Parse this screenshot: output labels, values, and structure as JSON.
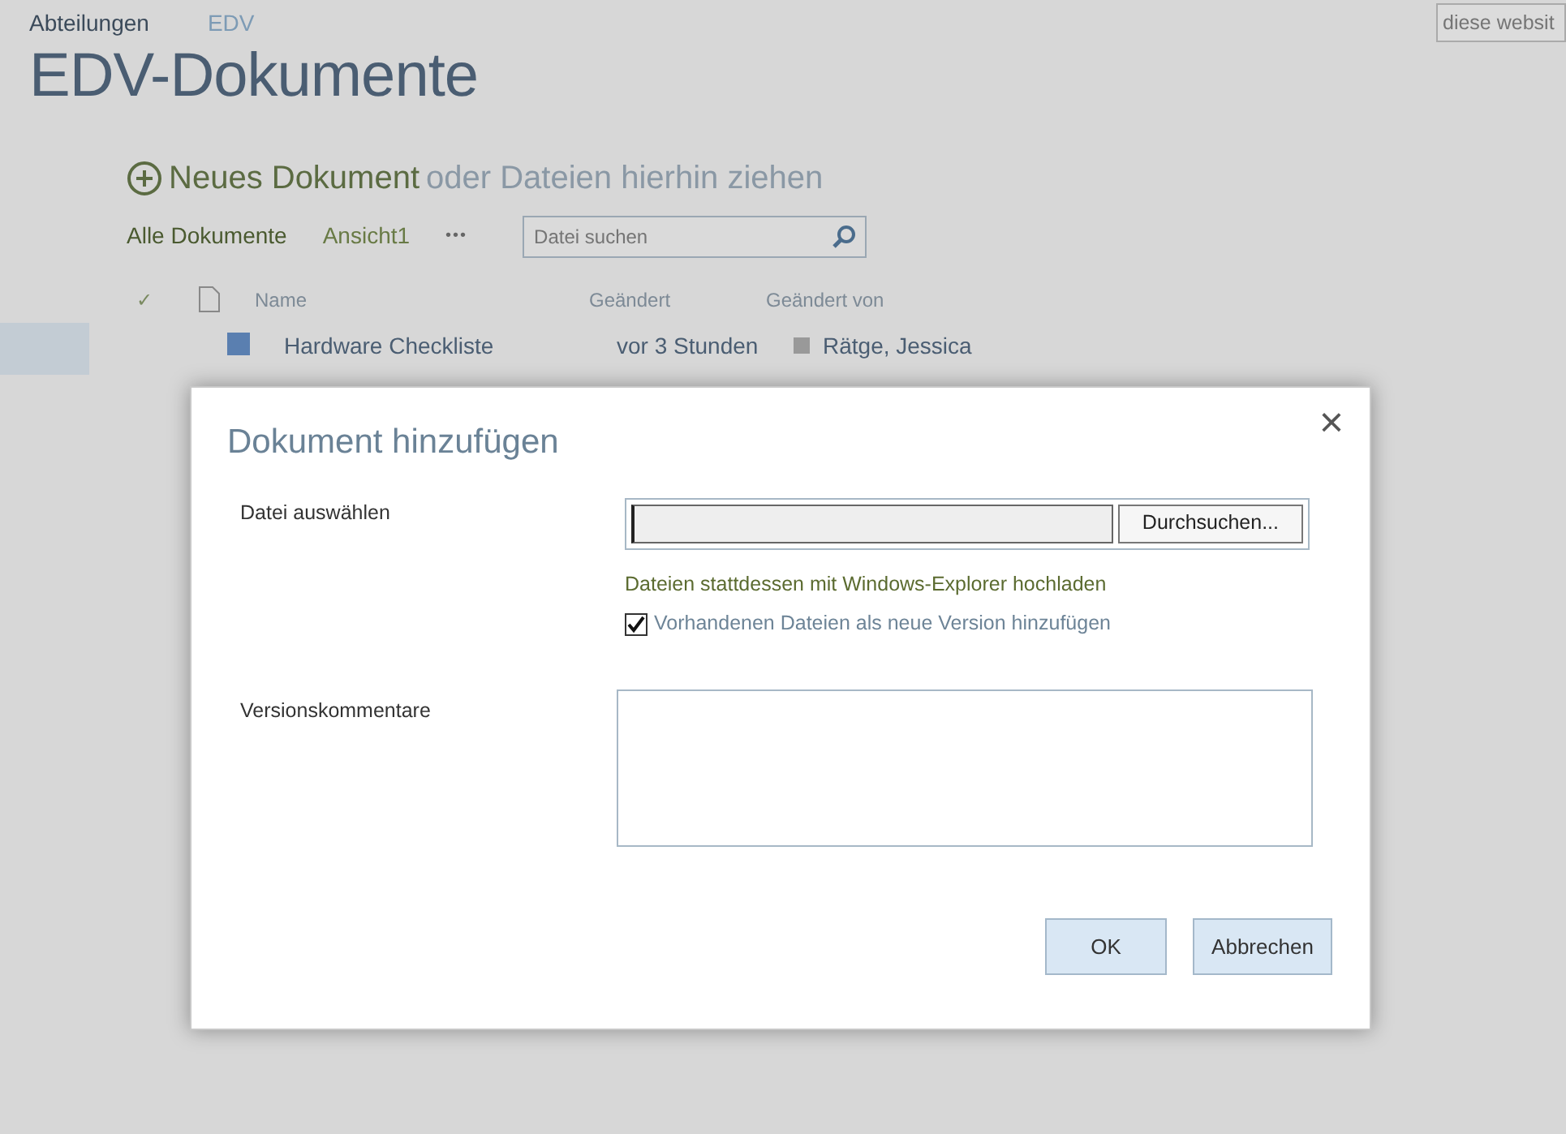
{
  "breadcrumb": [
    {
      "label": "Abteilungen",
      "selected": false
    },
    {
      "label": "EDV",
      "selected": true
    }
  ],
  "site_search": {
    "placeholder": "diese websit"
  },
  "page_title": "EDV-Dokumente",
  "new_document": {
    "label": "Neues Dokument",
    "hint": "oder Dateien hierhin ziehen"
  },
  "views": [
    {
      "label": "Alle Dokumente",
      "selected": true
    },
    {
      "label": "Ansicht1",
      "selected": false
    }
  ],
  "more": "•••",
  "file_search": {
    "placeholder": "Datei suchen"
  },
  "table": {
    "check": "✓",
    "columns": [
      "Name",
      "Geändert",
      "Geändert von"
    ],
    "rows": [
      {
        "name": "Hardware Checkliste",
        "modified": "vor 3 Stunden",
        "modified_by": "Rätge, Jessica"
      }
    ]
  },
  "dialog": {
    "title": "Dokument hinzufügen",
    "close": "×",
    "file_label": "Datei auswählen",
    "browse": "Durchsuchen...",
    "explorer_link": "Dateien stattdessen mit Windows-Explorer hochladen",
    "overwrite": {
      "label": "Vorhandenen Dateien als neue Version hinzufügen",
      "checked": true
    },
    "comments_label": "Versionskommentare",
    "buttons": [
      "OK",
      "Abbrechen"
    ]
  }
}
